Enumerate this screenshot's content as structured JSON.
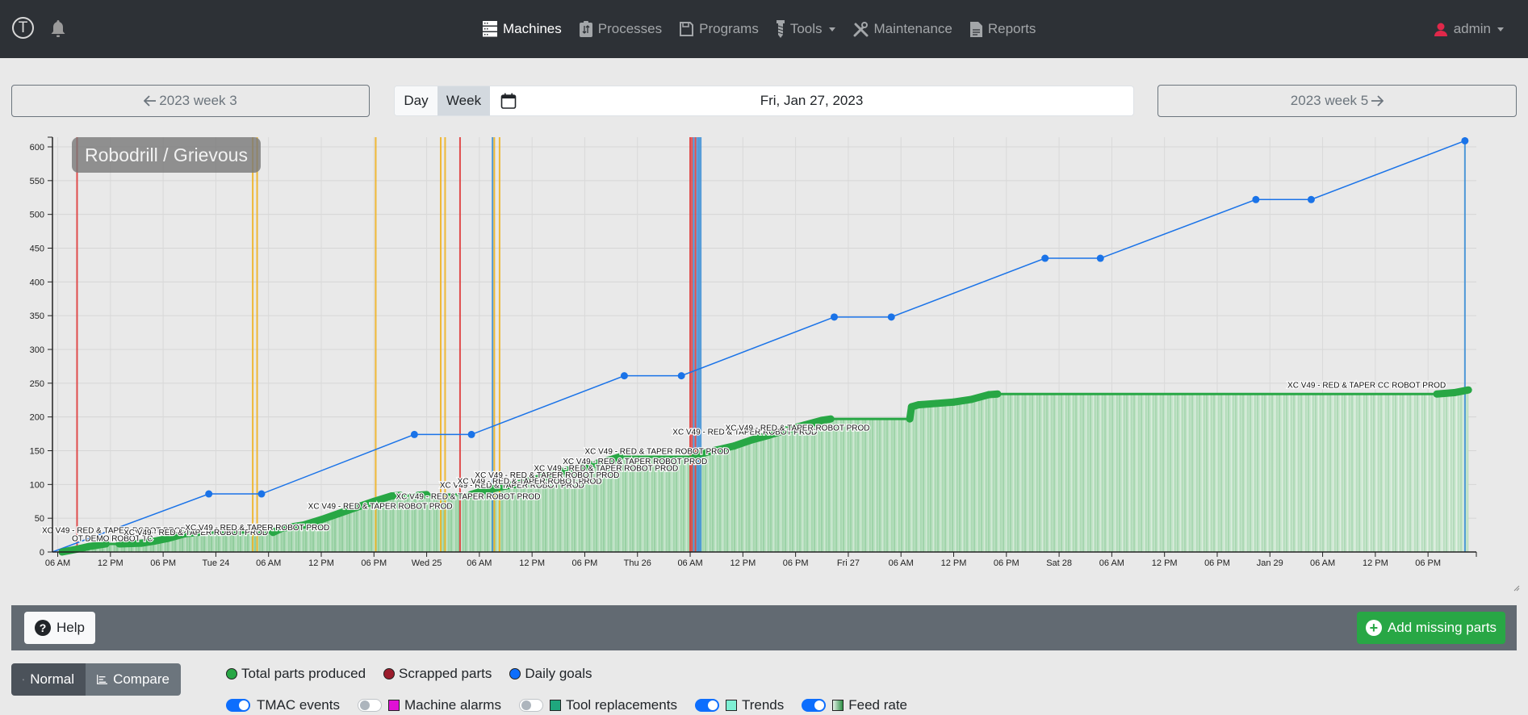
{
  "navbar": {
    "logo_letter": "T",
    "items": [
      {
        "label": "Machines",
        "icon": "server-icon",
        "active": true
      },
      {
        "label": "Processes",
        "icon": "clipboard-icon",
        "active": false
      },
      {
        "label": "Programs",
        "icon": "floppy-icon",
        "active": false
      },
      {
        "label": "Tools",
        "icon": "drill-icon",
        "active": false,
        "dropdown": true
      },
      {
        "label": "Maintenance",
        "icon": "tools-icon",
        "active": false
      },
      {
        "label": "Reports",
        "icon": "document-icon",
        "active": false
      }
    ],
    "user": "admin"
  },
  "datenav": {
    "prev_week": "2023 week 3",
    "next_week": "2023 week 5",
    "day_label": "Day",
    "week_label": "Week",
    "selected_mode": "Week",
    "date": "Fri, Jan 27, 2023"
  },
  "chart_title": "Robodrill / Grievous",
  "colors": {
    "parts": "#28a745",
    "goals": "#1a73e8",
    "tmac_orange": "#f0b323",
    "tmac_red": "#e03c3c",
    "tmac_blue": "#3d8fd6"
  },
  "chart_data": {
    "type": "line",
    "title": "Robodrill / Grievous",
    "xlabel": "",
    "ylabel": "",
    "x_unit": "hours since Mon Jan 23 00:00",
    "xlim": [
      5.4,
      167.5
    ],
    "ylim": [
      0,
      620
    ],
    "y_ticks": [
      0,
      50,
      100,
      150,
      200,
      250,
      300,
      350,
      400,
      450,
      500,
      550,
      600
    ],
    "x_ticks": [
      {
        "h": 6,
        "label": "06 AM"
      },
      {
        "h": 12,
        "label": "12 PM"
      },
      {
        "h": 18,
        "label": "06 PM"
      },
      {
        "h": 24,
        "label": "Tue 24"
      },
      {
        "h": 30,
        "label": "06 AM"
      },
      {
        "h": 36,
        "label": "12 PM"
      },
      {
        "h": 42,
        "label": "06 PM"
      },
      {
        "h": 48,
        "label": "Wed 25"
      },
      {
        "h": 54,
        "label": "06 AM"
      },
      {
        "h": 60,
        "label": "12 PM"
      },
      {
        "h": 66,
        "label": "06 PM"
      },
      {
        "h": 72,
        "label": "Thu 26"
      },
      {
        "h": 78,
        "label": "06 AM"
      },
      {
        "h": 84,
        "label": "12 PM"
      },
      {
        "h": 90,
        "label": "06 PM"
      },
      {
        "h": 96,
        "label": "Fri 27"
      },
      {
        "h": 102,
        "label": "06 AM"
      },
      {
        "h": 108,
        "label": "12 PM"
      },
      {
        "h": 114,
        "label": "06 PM"
      },
      {
        "h": 120,
        "label": "Sat 28"
      },
      {
        "h": 126,
        "label": "06 AM"
      },
      {
        "h": 132,
        "label": "12 PM"
      },
      {
        "h": 138,
        "label": "06 PM"
      },
      {
        "h": 144,
        "label": "Jan 29"
      },
      {
        "h": 150,
        "label": "06 AM"
      },
      {
        "h": 156,
        "label": "12 PM"
      },
      {
        "h": 162,
        "label": "06 PM"
      }
    ],
    "grid": true,
    "series": [
      {
        "name": "Daily goals",
        "color": "#1a73e8",
        "points": [
          [
            5.4,
            0
          ],
          [
            23.2,
            86
          ],
          [
            29.2,
            86
          ],
          [
            46.6,
            174
          ],
          [
            53.1,
            174
          ],
          [
            70.5,
            261
          ],
          [
            77.0,
            261
          ],
          [
            94.4,
            348
          ],
          [
            100.9,
            348
          ],
          [
            118.4,
            435
          ],
          [
            124.7,
            435
          ],
          [
            142.4,
            522
          ],
          [
            148.7,
            522
          ],
          [
            166.2,
            609
          ]
        ]
      },
      {
        "name": "Total parts produced",
        "color": "#28a745",
        "points": [
          [
            6.5,
            0
          ],
          [
            8.5,
            5
          ],
          [
            9.5,
            8
          ],
          [
            11.5,
            12
          ],
          [
            13,
            12
          ],
          [
            15.5,
            13
          ],
          [
            17,
            16
          ],
          [
            18.5,
            20
          ],
          [
            20.5,
            27
          ],
          [
            22,
            29
          ],
          [
            30.5,
            29
          ],
          [
            31.5,
            35
          ],
          [
            34,
            40
          ],
          [
            36,
            48
          ],
          [
            38,
            57
          ],
          [
            40,
            66
          ],
          [
            42,
            75
          ],
          [
            44,
            83
          ],
          [
            45,
            84
          ],
          [
            47,
            84
          ],
          [
            48,
            85
          ],
          [
            53,
            85
          ],
          [
            54,
            89
          ],
          [
            56,
            95
          ],
          [
            58,
            100
          ],
          [
            59,
            103
          ],
          [
            61,
            110
          ],
          [
            63,
            118
          ],
          [
            65,
            124
          ],
          [
            67,
            130
          ],
          [
            69,
            137
          ],
          [
            70,
            141
          ],
          [
            78.5,
            141
          ],
          [
            79,
            145
          ],
          [
            81,
            151
          ],
          [
            83,
            157
          ],
          [
            85,
            166
          ],
          [
            87,
            173
          ],
          [
            89,
            181
          ],
          [
            91,
            188
          ],
          [
            93,
            195
          ],
          [
            94,
            197
          ],
          [
            103,
            197
          ],
          [
            103.2,
            215
          ],
          [
            104,
            218
          ],
          [
            106,
            220
          ],
          [
            108,
            222
          ],
          [
            110,
            226
          ],
          [
            112,
            233
          ],
          [
            113,
            234
          ],
          [
            163,
            234
          ],
          [
            165,
            236
          ],
          [
            166.6,
            240
          ]
        ]
      }
    ],
    "tmac_events": [
      {
        "h": 8.2,
        "color": "red"
      },
      {
        "h": 28.2,
        "color": "orange"
      },
      {
        "h": 28.7,
        "color": "orange"
      },
      {
        "h": 42.2,
        "color": "orange"
      },
      {
        "h": 49.6,
        "color": "orange"
      },
      {
        "h": 50.1,
        "color": "orange"
      },
      {
        "h": 51.8,
        "color": "red"
      },
      {
        "h": 55.5,
        "color": "blue"
      },
      {
        "h": 55.7,
        "color": "orange"
      },
      {
        "h": 56.3,
        "color": "orange"
      },
      {
        "h": 78.0,
        "color": "red"
      },
      {
        "h": 78.2,
        "color": "red"
      },
      {
        "h": 78.4,
        "color": "blue"
      },
      {
        "h": 78.6,
        "color": "red"
      },
      {
        "h": 78.8,
        "color": "blue"
      },
      {
        "h": 79.0,
        "color": "blue"
      },
      {
        "h": 79.2,
        "color": "blue"
      },
      {
        "h": 166.2,
        "color": "blue"
      }
    ],
    "program_labels": [
      {
        "h": 4.2,
        "y": 28,
        "text": "XC V49 - RED & TAPER ROBOT PROD"
      },
      {
        "h": 7.6,
        "y": 16,
        "text": "OT DEMO ROBOT TC"
      },
      {
        "h": 13.5,
        "y": 25,
        "text": "XC V49 - RED & TAPER ROBOT PROD"
      },
      {
        "h": 20.5,
        "y": 32,
        "text": "XC V49 - RED & TAPER ROBOT PROD"
      },
      {
        "h": 34.5,
        "y": 64,
        "text": "XC V49 - RED & TAPER ROBOT PROD"
      },
      {
        "h": 44.5,
        "y": 78,
        "text": "XC V49 - RED & TAPER ROBOT PROD"
      },
      {
        "h": 49.5,
        "y": 95,
        "text": "XC V49 - RED & TAPER ROBOT PROD"
      },
      {
        "h": 51.5,
        "y": 101,
        "text": "XC V49 - RED & TAPER ROBOT PROD"
      },
      {
        "h": 53.5,
        "y": 110,
        "text": "XC V49 - RED & TAPER ROBOT PROD"
      },
      {
        "h": 60.2,
        "y": 120,
        "text": "XC V49 - RED & TAPER ROBOT PROD"
      },
      {
        "h": 63.5,
        "y": 130,
        "text": "XC V49 - RED & TAPER ROBOT PROD"
      },
      {
        "h": 66.0,
        "y": 145,
        "text": "XC V49 - RED & TAPER ROBOT PROD"
      },
      {
        "h": 76.0,
        "y": 174,
        "text": "XC V49 - RED & TAPER ROBOT PROD"
      },
      {
        "h": 82.0,
        "y": 180,
        "text": "XC V49 - RED & TAPER ROBOT PROD"
      },
      {
        "h": 146.0,
        "y": 243,
        "text": "XC V49 - RED & TAPER CC ROBOT PROD"
      }
    ]
  },
  "toolbar": {
    "help_label": "Help",
    "add_label": "Add missing parts"
  },
  "modes": {
    "normal_label": "Normal",
    "compare_label": "Compare",
    "active": "Normal"
  },
  "legend": {
    "series": [
      {
        "label": "Total parts produced",
        "color": "#28a745"
      },
      {
        "label": "Scrapped parts",
        "color": "#9b1c2c"
      },
      {
        "label": "Daily goals",
        "color": "#0d6efd"
      }
    ],
    "toggles": [
      {
        "label": "TMAC events",
        "on": true,
        "swatch": null
      },
      {
        "label": "Machine alarms",
        "on": false,
        "swatch": "#e010d6"
      },
      {
        "label": "Tool replacements",
        "on": false,
        "swatch": "#1fa77e"
      },
      {
        "label": "Trends",
        "on": true,
        "swatch": "#7ef0d4"
      },
      {
        "label": "Feed rate",
        "on": true,
        "swatch": "gradient"
      }
    ]
  }
}
